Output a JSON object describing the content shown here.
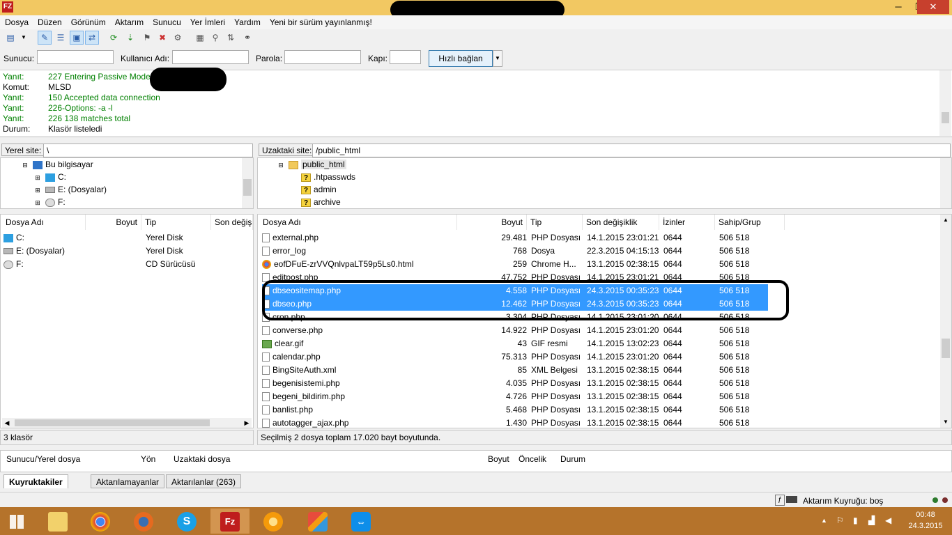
{
  "window": {
    "app_icon": "FZ",
    "min_glyph": "─",
    "max_glyph": "❐",
    "close_glyph": "✕"
  },
  "menu": [
    "Dosya",
    "Düzen",
    "Görünüm",
    "Aktarım",
    "Sunucu",
    "Yer İmleri",
    "Yardım",
    "Yeni bir sürüm yayınlanmış!"
  ],
  "toolbar": {
    "icons": [
      "site-manager-icon",
      "dropdown-icon",
      "toggle-log-icon",
      "toggle-local-tree-icon",
      "toggle-remote-tree-icon",
      "toggle-queue-icon",
      "refresh-icon",
      "process-queue-icon",
      "cancel-icon",
      "disconnect-icon",
      "reconnect-icon",
      "filter-icon",
      "compare-icon",
      "sync-browse-icon",
      "search-icon"
    ]
  },
  "quickconnect": {
    "host_label": "Sunucu:",
    "user_label": "Kullanıcı Adı:",
    "pass_label": "Parola:",
    "port_label": "Kapı:",
    "connect_label": "Hızlı bağlan",
    "dropdown_glyph": "▼"
  },
  "log": [
    {
      "k": "Yanıt:",
      "v": "227 Entering Passive Mode (",
      "green": true
    },
    {
      "k": "Komut:",
      "v": "MLSD",
      "green": false
    },
    {
      "k": "Yanıt:",
      "v": "150 Accepted data connection",
      "green": true
    },
    {
      "k": "Yanıt:",
      "v": "226-Options: -a -l",
      "green": true
    },
    {
      "k": "Yanıt:",
      "v": "226 138 matches total",
      "green": true
    },
    {
      "k": "Durum:",
      "v": "Klasör listeledi",
      "green": false
    }
  ],
  "local": {
    "site_label": "Yerel site:",
    "path": "\\",
    "tree": [
      {
        "label": "Bu bilgisayar",
        "icon": "computer-icon",
        "indent": 0,
        "highlight": true
      },
      {
        "label": "C:",
        "icon": "windows-drive-icon",
        "indent": 1,
        "highlight": false
      },
      {
        "label": "E: (Dosyalar)",
        "icon": "drive-icon",
        "indent": 1,
        "highlight": false
      },
      {
        "label": "F:",
        "icon": "cd-drive-icon",
        "indent": 1,
        "highlight": false
      }
    ],
    "columns": [
      "Dosya Adı",
      "Boyut",
      "Tip",
      "Son değişi"
    ],
    "files": [
      {
        "name": "C:",
        "size": "",
        "type": "Yerel Disk",
        "icon": "windows-drive-icon"
      },
      {
        "name": "E: (Dosyalar)",
        "size": "",
        "type": "Yerel Disk",
        "icon": "drive-icon"
      },
      {
        "name": "F:",
        "size": "",
        "type": "CD Sürücüsü",
        "icon": "cd-drive-icon"
      }
    ],
    "status": "3 klasör"
  },
  "remote": {
    "site_label": "Uzaktaki site:",
    "path": "/public_html",
    "tree": [
      {
        "label": "public_html",
        "icon": "folder-icon",
        "indent": 0,
        "highlight": true
      },
      {
        "label": ".htpasswds",
        "icon": "unknown-folder-icon",
        "indent": 1,
        "highlight": false
      },
      {
        "label": "admin",
        "icon": "unknown-folder-icon",
        "indent": 1,
        "highlight": false
      },
      {
        "label": "archive",
        "icon": "unknown-folder-icon",
        "indent": 1,
        "highlight": false
      }
    ],
    "columns": [
      "Dosya Adı",
      "Boyut",
      "Tip",
      "Son değişiklik",
      "İzinler",
      "Sahip/Grup"
    ],
    "files": [
      {
        "name": "external.php",
        "size": "29.481",
        "type": "PHP Dosyası",
        "modified": "14.1.2015 23:01:21",
        "perm": "0644",
        "owner": "506 518",
        "icon": "file-icon",
        "selected": false
      },
      {
        "name": "error_log",
        "size": "768",
        "type": "Dosya",
        "modified": "22.3.2015 04:15:13",
        "perm": "0644",
        "owner": "506 518",
        "icon": "file-icon",
        "selected": false
      },
      {
        "name": "eofDFuE-zrVVQnlvpaLT59p5Ls0.html",
        "size": "259",
        "type": "Chrome H...",
        "modified": "13.1.2015 02:38:15",
        "perm": "0644",
        "owner": "506 518",
        "icon": "chrome-icon",
        "selected": false
      },
      {
        "name": "editpost.php",
        "size": "47.752",
        "type": "PHP Dosyası",
        "modified": "14.1.2015 23:01:21",
        "perm": "0644",
        "owner": "506 518",
        "icon": "file-icon",
        "selected": false
      },
      {
        "name": "dbseositemap.php",
        "size": "4.558",
        "type": "PHP Dosyası",
        "modified": "24.3.2015 00:35:23",
        "perm": "0644",
        "owner": "506 518",
        "icon": "file-icon",
        "selected": true
      },
      {
        "name": "dbseo.php",
        "size": "12.462",
        "type": "PHP Dosyası",
        "modified": "24.3.2015 00:35:23",
        "perm": "0644",
        "owner": "506 518",
        "icon": "file-icon",
        "selected": true
      },
      {
        "name": "cron.php",
        "size": "3.304",
        "type": "PHP Dosyası",
        "modified": "14.1.2015 23:01:20",
        "perm": "0644",
        "owner": "506 518",
        "icon": "file-icon",
        "selected": false
      },
      {
        "name": "converse.php",
        "size": "14.922",
        "type": "PHP Dosyası",
        "modified": "14.1.2015 23:01:20",
        "perm": "0644",
        "owner": "506 518",
        "icon": "file-icon",
        "selected": false
      },
      {
        "name": "clear.gif",
        "size": "43",
        "type": "GIF resmi",
        "modified": "14.1.2015 13:02:23",
        "perm": "0644",
        "owner": "506 518",
        "icon": "image-icon",
        "selected": false
      },
      {
        "name": "calendar.php",
        "size": "75.313",
        "type": "PHP Dosyası",
        "modified": "14.1.2015 23:01:20",
        "perm": "0644",
        "owner": "506 518",
        "icon": "file-icon",
        "selected": false
      },
      {
        "name": "BingSiteAuth.xml",
        "size": "85",
        "type": "XML Belgesi",
        "modified": "13.1.2015 02:38:15",
        "perm": "0644",
        "owner": "506 518",
        "icon": "file-icon",
        "selected": false
      },
      {
        "name": "begenisistemi.php",
        "size": "4.035",
        "type": "PHP Dosyası",
        "modified": "13.1.2015 02:38:15",
        "perm": "0644",
        "owner": "506 518",
        "icon": "file-icon",
        "selected": false
      },
      {
        "name": "begeni_bildirim.php",
        "size": "4.726",
        "type": "PHP Dosyası",
        "modified": "13.1.2015 02:38:15",
        "perm": "0644",
        "owner": "506 518",
        "icon": "file-icon",
        "selected": false
      },
      {
        "name": "banlist.php",
        "size": "5.468",
        "type": "PHP Dosyası",
        "modified": "13.1.2015 02:38:15",
        "perm": "0644",
        "owner": "506 518",
        "icon": "file-icon",
        "selected": false
      },
      {
        "name": "autotagger_ajax.php",
        "size": "1.430",
        "type": "PHP Dosyası",
        "modified": "13.1.2015 02:38:15",
        "perm": "0644",
        "owner": "506 518",
        "icon": "file-icon",
        "selected": false
      }
    ],
    "status": "Seçilmiş 2 dosya toplam 17.020 bayt boyutunda."
  },
  "queue": {
    "columns": [
      "Sunucu/Yerel dosya",
      "Yön",
      "Uzaktaki dosya",
      "Boyut",
      "Öncelik",
      "Durum"
    ]
  },
  "tabs": [
    {
      "label": "Kuyruktakiler",
      "active": true
    },
    {
      "label": "Aktarılamayanlar",
      "active": false
    },
    {
      "label": "Aktarılanlar (263)",
      "active": false
    }
  ],
  "bottom_status": {
    "queue_text": "Aktarım Kuyruğu: boş"
  },
  "taskbar": {
    "apps": [
      {
        "name": "file-explorer-icon",
        "active": false
      },
      {
        "name": "chrome-icon",
        "active": false
      },
      {
        "name": "firefox-icon",
        "active": false
      },
      {
        "name": "skype-icon",
        "active": false
      },
      {
        "name": "filezilla-icon",
        "active": true
      },
      {
        "name": "messenger-icon",
        "active": false
      },
      {
        "name": "paint-icon",
        "active": false
      },
      {
        "name": "teamviewer-icon",
        "active": false
      }
    ],
    "time": "00:48",
    "date": "24.3.2015"
  },
  "colors": {
    "titlebar": "#f2c862",
    "selection": "#3399ff",
    "log_green": "#008000",
    "taskbar": "#b5732b",
    "close": "#c7402d"
  }
}
